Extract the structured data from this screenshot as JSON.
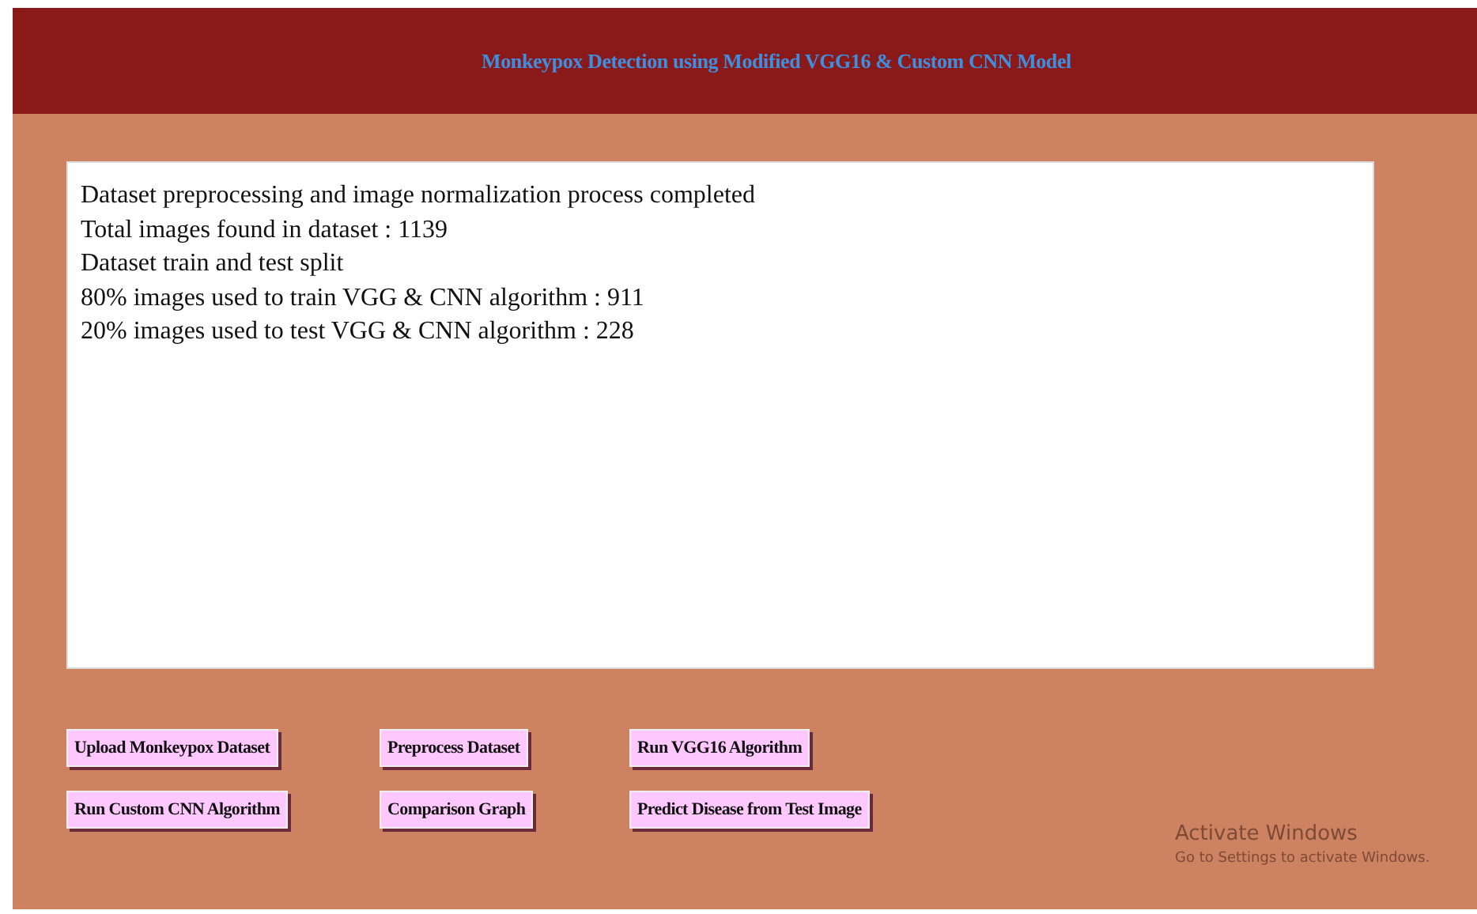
{
  "window": {
    "title": "Monkeypox Detection using Modified VGG16 & Custom CNN Model"
  },
  "output": {
    "lines": [
      "Dataset preprocessing and image normalization process completed",
      "Total images found in dataset : 1139",
      "Dataset train and test split",
      "80% images used to train VGG & CNN algorithm : 911",
      "20% images used to test VGG & CNN algorithm : 228"
    ]
  },
  "buttons": [
    "Upload Monkeypox Dataset",
    "Preprocess Dataset",
    "Run VGG16 Algorithm",
    "Run Custom CNN Algorithm",
    "Comparison Graph",
    "Predict Disease from Test Image"
  ],
  "activation_notice": {
    "title": "Activate Windows",
    "subtitle": "Go to Settings to activate Windows."
  }
}
